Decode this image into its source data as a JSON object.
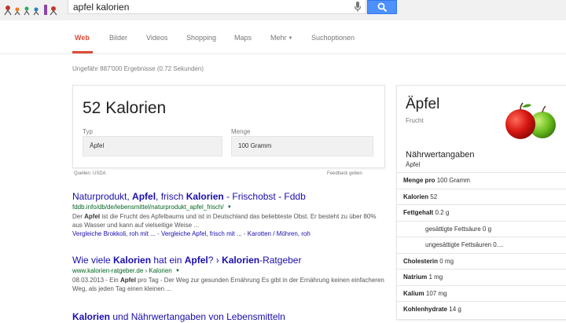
{
  "search": {
    "query": "apfel kalorien"
  },
  "colors": {
    "accent": "#dd4b39",
    "search_button": "#4d90fe",
    "link": "#1a0dab",
    "url": "#006621"
  },
  "icons": {
    "mic": "microphone-icon",
    "search": "magnifier-icon"
  },
  "tabs": [
    {
      "label": "Web",
      "active": true
    },
    {
      "label": "Bilder"
    },
    {
      "label": "Videos"
    },
    {
      "label": "Shopping"
    },
    {
      "label": "Maps"
    },
    {
      "label": "Mehr"
    },
    {
      "label": "Suchoptionen"
    }
  ],
  "stats": "Ungefähr 887'000 Ergebnisse (0.72 Sekunden)",
  "calculator": {
    "value": "52 Kalorien",
    "type_label": "Typ",
    "type_value": "Äpfel",
    "amount_label": "Menge",
    "amount_value": "100 Gramm",
    "source": "Quellen: USDA",
    "feedback": "Feedback geben"
  },
  "results": [
    {
      "title_parts": [
        "Naturprodukt, ",
        "Apfel",
        ", frisch ",
        "Kalorien",
        " - Frischobst - Fddb"
      ],
      "url": "fddb.info/db/de/lebensmittel/naturprodukt_apfel_frisch/",
      "snippet_parts": [
        "Der ",
        "Apfel",
        " ist die Frucht des Apfelbaums und ist in Deutschland das beliebteste Obst. Er besteht zu über 80% aus Wasser und kann auf vielseitige Weise ..."
      ],
      "links": [
        "Vergleiche Brokkoli, roh mit ...",
        "Vergleiche Apfel, frisch mit ...",
        "Karotten / Möhren, roh"
      ]
    },
    {
      "title_parts": [
        "Wie viele ",
        "Kalorien",
        " hat ein ",
        "Apfel",
        "? › ",
        "Kalorien",
        "-Ratgeber"
      ],
      "url": "www.kalorien-ratgeber.de › Kalorien",
      "snippet_parts": [
        "08.03.2013 - Ein ",
        "Apfel",
        " pro Tag - Der Weg zur gesunden Ernährung Es gibt in der Ernährung keinen einfacheren Weg, als jeden Tag einen kleinen ..."
      ]
    },
    {
      "title_parts": [
        "Kalorien",
        " und Nährwertangaben von Lebensmitteln"
      ]
    }
  ],
  "knowledge_panel": {
    "title": "Äpfel",
    "subtitle": "Frucht",
    "section_title": "Nährwertangaben",
    "section_subtitle": "Äpfel",
    "rows": [
      {
        "label": "Menge pro",
        "value": "100 Gramm",
        "indent": false
      },
      {
        "label": "Kalorien",
        "value": "52",
        "indent": false
      },
      {
        "label": "Fettgehalt",
        "value": "0.2 g",
        "indent": false
      },
      {
        "label": "",
        "value": "gesättigte Fettsäure 0 g",
        "indent": true
      },
      {
        "label": "",
        "value": "ungesättigte Fettsäuren 0....",
        "indent": true
      },
      {
        "label": "Cholesterin",
        "value": "0 mg",
        "indent": false
      },
      {
        "label": "Natrium",
        "value": "1 mg",
        "indent": false
      },
      {
        "label": "Kalium",
        "value": "107 mg",
        "indent": false
      },
      {
        "label": "Kohlenhydrate",
        "value": "14 g",
        "indent": false
      }
    ]
  }
}
